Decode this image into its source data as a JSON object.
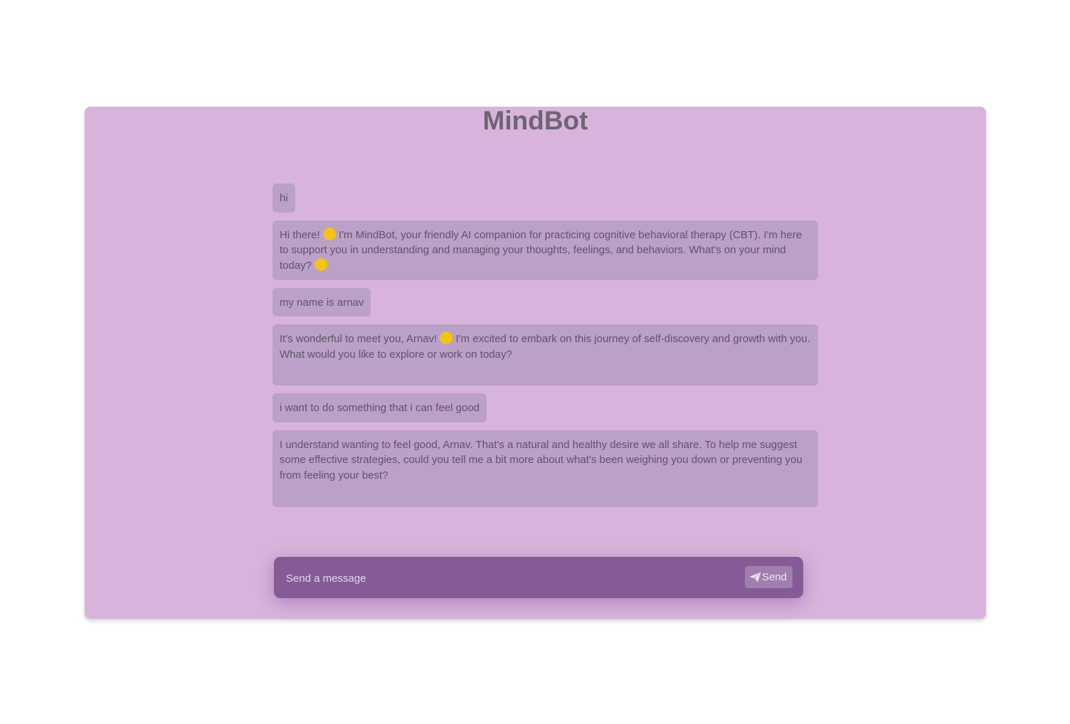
{
  "app": {
    "title": "MindBot"
  },
  "messages": [
    {
      "role": "user",
      "text": "hi"
    },
    {
      "role": "bot",
      "parts": [
        "Hi there! ",
        " I'm MindBot, your friendly AI companion for practicing cognitive behavioral therapy (CBT). I'm here to support you in understanding and managing your thoughts, feelings, and behaviors. What's on your mind today? "
      ],
      "emojis": [
        "waving-hand-emoji",
        "thinking-face-emoji"
      ]
    },
    {
      "role": "user",
      "text": "my name is arnav"
    },
    {
      "role": "bot",
      "parts": [
        "It's wonderful to meet you, Arnav! ",
        " I'm excited to embark on this journey of self-discovery and growth with you. What would you like to explore or work on today?"
      ],
      "emojis": [
        "smiling-face-emoji"
      ]
    },
    {
      "role": "user",
      "text": "i want to do something that i can feel good"
    },
    {
      "role": "bot",
      "text": "I understand wanting to feel good, Arnav. That's a natural and healthy desire we all share. To help me suggest some effective strategies, could you tell me a bit more about what's been weighing you down or preventing you from feeling your best?"
    }
  ],
  "composer": {
    "placeholder": "Send a message",
    "send_label": "Send",
    "send_icon": "paper-plane-icon"
  },
  "colors": {
    "card_background": "#d8b4dc",
    "bubble_background": "#bba0c8",
    "input_bar": "#865a96",
    "emoji": "#f2c318"
  }
}
